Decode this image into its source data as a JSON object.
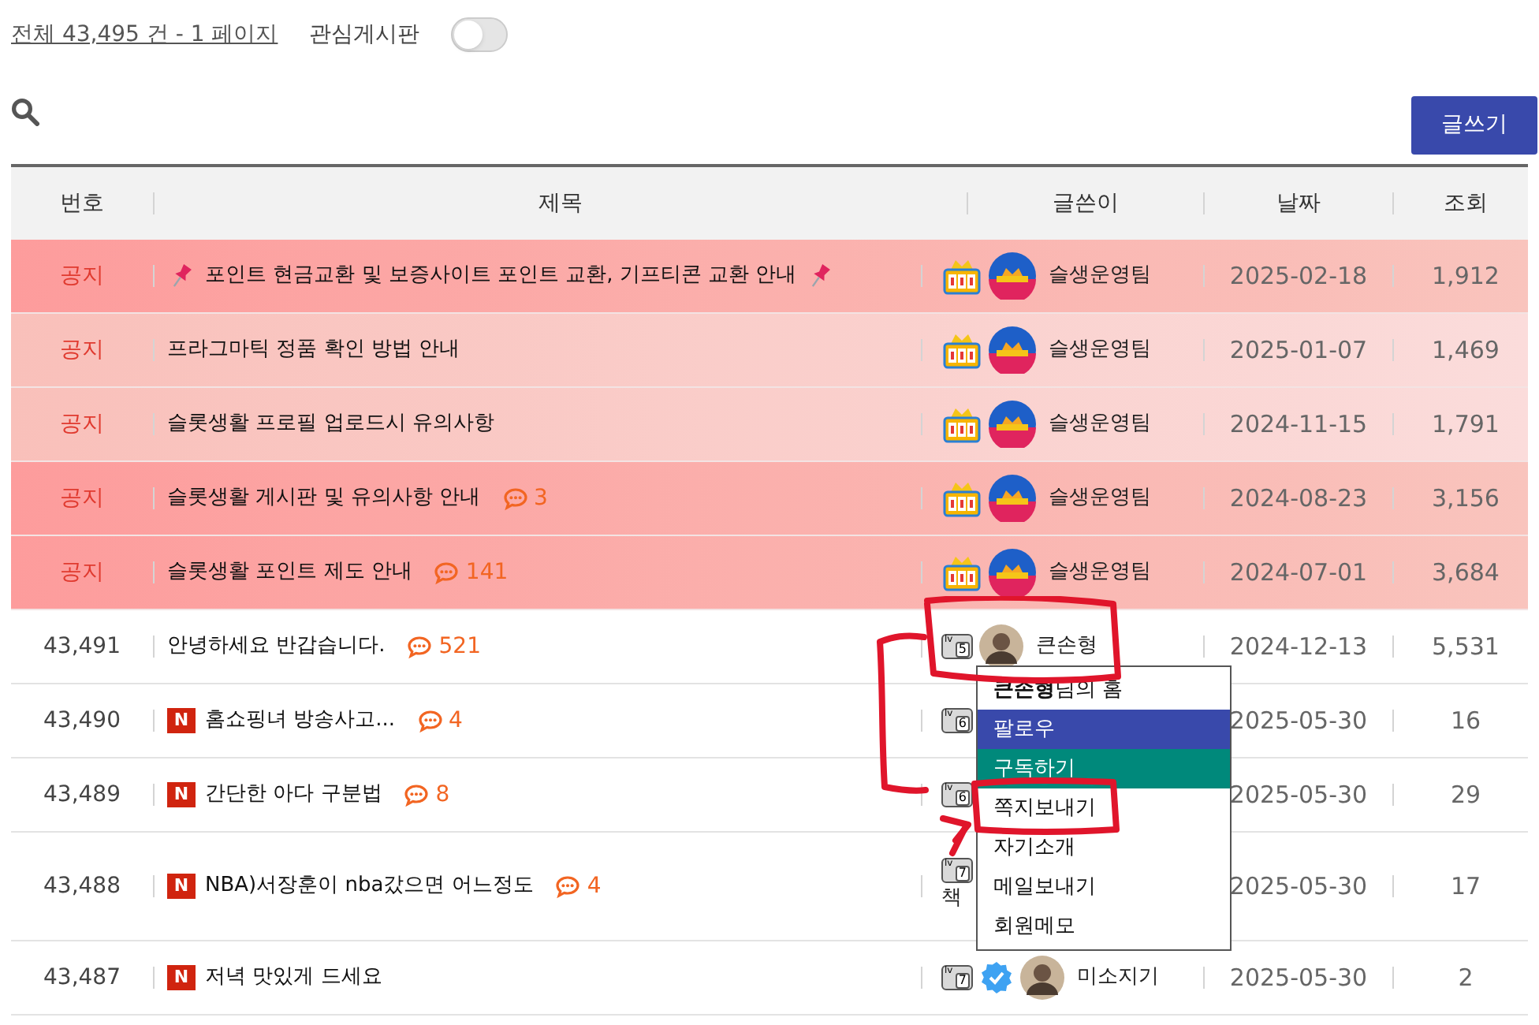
{
  "summary": {
    "link": "전체 43,495 건 - 1 페이지",
    "favorite_label": "관심게시판",
    "favorite_on": false
  },
  "write_button": "글쓰기",
  "table": {
    "columns": [
      "번호",
      "제목",
      "글쓴이",
      "날짜",
      "조회"
    ],
    "rows": [
      {
        "kind": "notice",
        "emphasized": true,
        "number": "공지",
        "pin_before": true,
        "pin_after": true,
        "title": "포인트 현금교환 및 보증사이트 포인트 교환, 기프티콘 교환 안내",
        "writer": {
          "kind": "staff",
          "name": "슬생운영팀"
        },
        "date": "2025-02-18",
        "views": "1,912"
      },
      {
        "kind": "notice",
        "emphasized": false,
        "number": "공지",
        "pin_before": false,
        "pin_after": false,
        "title": "프라그마틱 정품 확인 방법 안내",
        "writer": {
          "kind": "staff",
          "name": "슬생운영팀"
        },
        "date": "2025-01-07",
        "views": "1,469"
      },
      {
        "kind": "notice",
        "emphasized": false,
        "number": "공지",
        "pin_before": false,
        "pin_after": false,
        "title": "슬롯생활 프로필 업로드시 유의사항",
        "writer": {
          "kind": "staff",
          "name": "슬생운영팀"
        },
        "date": "2024-11-15",
        "views": "1,791"
      },
      {
        "kind": "notice",
        "emphasized": true,
        "number": "공지",
        "pin_before": false,
        "pin_after": false,
        "title": "슬롯생활 게시판 및 유의사항 안내",
        "comments": "3",
        "writer": {
          "kind": "staff",
          "name": "슬생운영팀"
        },
        "date": "2024-08-23",
        "views": "3,156"
      },
      {
        "kind": "notice",
        "emphasized": true,
        "number": "공지",
        "pin_before": false,
        "pin_after": false,
        "title": "슬롯생활 포인트 제도 안내",
        "comments": "141",
        "writer": {
          "kind": "staff",
          "name": "슬생운영팀"
        },
        "date": "2024-07-01",
        "views": "3,684"
      },
      {
        "kind": "post",
        "number": "43,491",
        "title": "안녕하세요 반갑습니다.",
        "comments": "521",
        "writer": {
          "kind": "member",
          "badge": {
            "prefix": "lv",
            "number": "5"
          },
          "avatar": true,
          "verified": false,
          "name": "큰손형"
        },
        "date": "2024-12-13",
        "views": "5,531"
      },
      {
        "kind": "post",
        "number": "43,490",
        "new_badge": "N",
        "title": "홈쇼핑녀 방송사고...",
        "comments": "4",
        "writer": {
          "kind": "member",
          "badge": {
            "prefix": "lv",
            "number": "6"
          },
          "avatar": false,
          "verified": false
        },
        "date": "2025-05-30",
        "views": "16"
      },
      {
        "kind": "post",
        "number": "43,489",
        "new_badge": "N",
        "title": "간단한 아다 구분법",
        "comments": "8",
        "writer": {
          "kind": "member",
          "badge": {
            "prefix": "lv",
            "number": "6"
          },
          "avatar": false,
          "verified": false
        },
        "date": "2025-05-30",
        "views": "29"
      },
      {
        "kind": "post",
        "number": "43,488",
        "new_badge": "N",
        "title": "NBA)서장훈이 nba갔으면 어느정도",
        "comments": "4",
        "writer": {
          "kind": "member",
          "badge": {
            "prefix": "lv",
            "number": "7"
          },
          "avatar": false,
          "verified": false,
          "name_below": "책"
        },
        "date": "2025-05-30",
        "views": "17"
      },
      {
        "kind": "post",
        "number": "43,487",
        "new_badge": "N",
        "title": "저녁 맛있게 드세요",
        "writer": {
          "kind": "member",
          "badge": {
            "prefix": "lv",
            "number": "7"
          },
          "avatar": true,
          "verified": true,
          "name": "미소지기"
        },
        "date": "2025-05-30",
        "views": "2"
      }
    ]
  },
  "member_menu": {
    "items": [
      {
        "label": "**큰손형**님의 홈"
      },
      {
        "label": "팔로우",
        "color": "#3949ab"
      },
      {
        "label": "구독하기",
        "color": "#00897b"
      },
      {
        "label": "쪽지보내기"
      },
      {
        "label": "자기소개"
      },
      {
        "label": "메일보내기"
      },
      {
        "label": "회원메모"
      }
    ]
  }
}
